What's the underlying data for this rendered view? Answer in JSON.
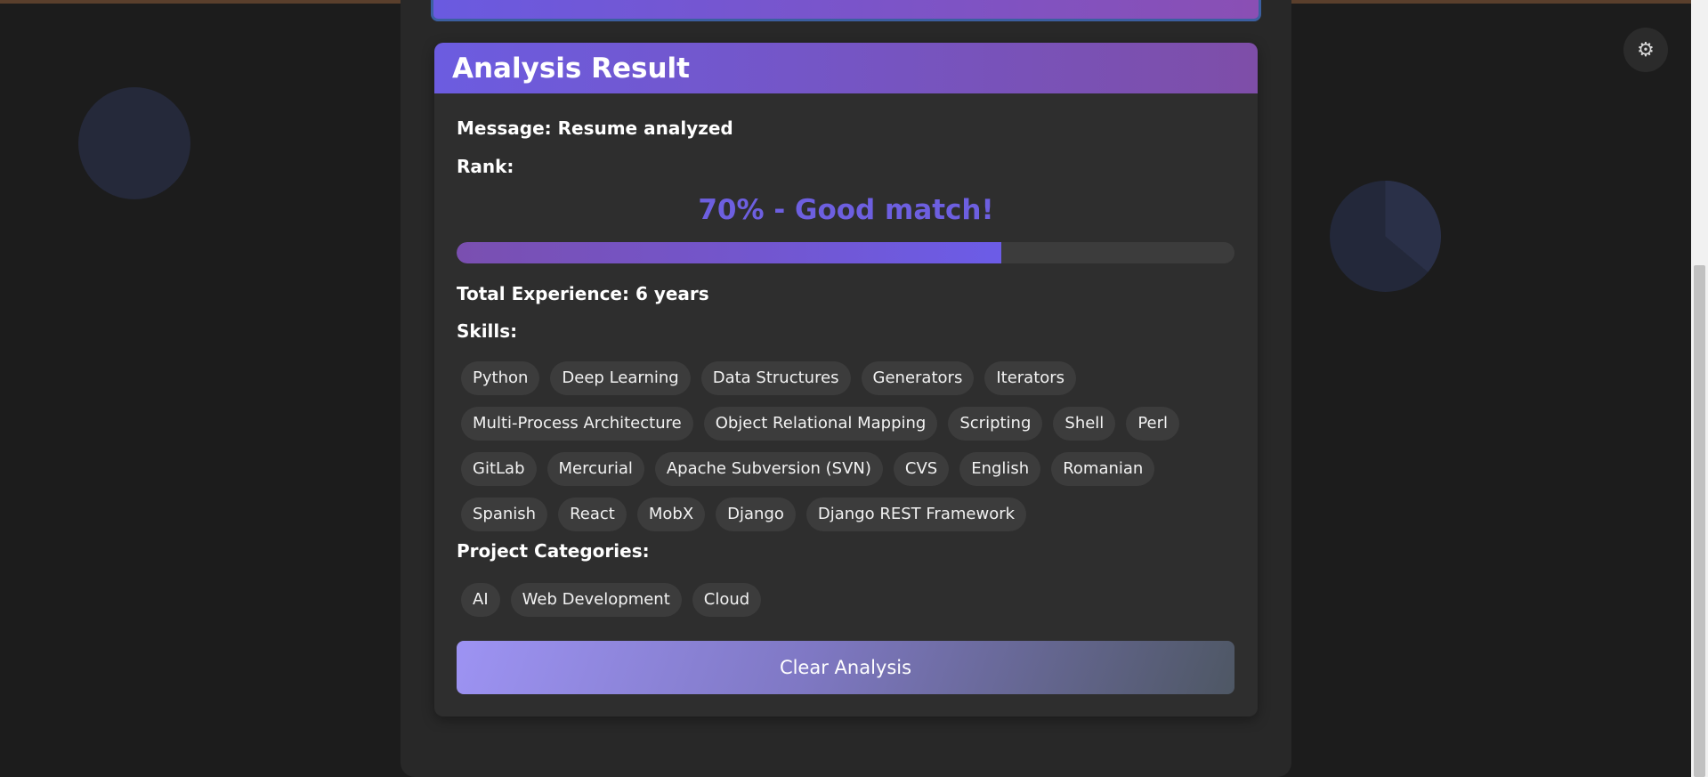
{
  "result": {
    "title": "Analysis Result",
    "message": "Message: Resume analyzed",
    "rank_label": "Rank:",
    "rank_text": "70% - Good match!",
    "rank_percent": 70,
    "experience": "Total Experience: 6 years",
    "skills_label": "Skills:",
    "skills": [
      "Python",
      "Deep Learning",
      "Data Structures",
      "Generators",
      "Iterators",
      "Multi-Process Architecture",
      "Object Relational Mapping",
      "Scripting",
      "Shell",
      "Perl",
      "GitLab",
      "Mercurial",
      "Apache Subversion (SVN)",
      "CVS",
      "English",
      "Romanian",
      "Spanish",
      "React",
      "MobX",
      "Django",
      "Django REST Framework"
    ],
    "categories_label": "Project Categories:",
    "categories": [
      "AI",
      "Web Development",
      "Cloud"
    ],
    "clear_button": "Clear Analysis"
  },
  "theme_toggle_icon": "gear-icon",
  "colors": {
    "accent": "#6c5ce7",
    "header_start": "#6c5ce0",
    "header_end": "#7e4ea8",
    "background": "#1c1c1c",
    "card": "#2e2e2e"
  }
}
